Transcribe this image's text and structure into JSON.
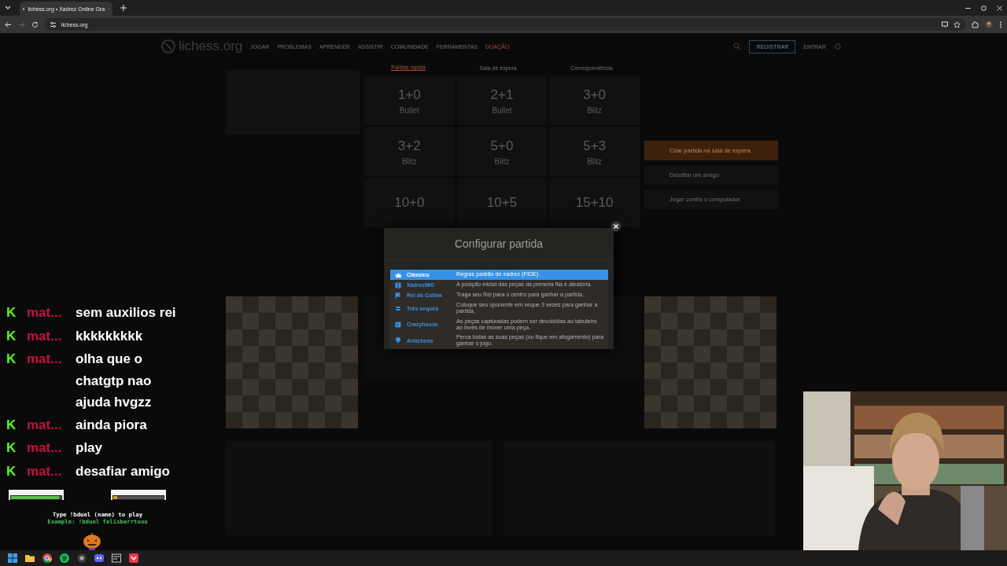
{
  "browser": {
    "tab": {
      "title": "lichess.org • Xadrez Online Gra"
    },
    "address": "lichess.org"
  },
  "site": {
    "logo": "lichess.org",
    "nav": [
      "JOGAR",
      "PROBLEMAS",
      "APRENDER",
      "ASSISTIR",
      "COMUNIDADE",
      "FERRAMENTAS",
      "DOAÇÃO"
    ],
    "register": "REGISTRAR",
    "login": "ENTRAR",
    "pool_tabs": [
      {
        "label": "Partida rápida",
        "selected": true
      },
      {
        "label": "Sala de espera",
        "selected": false
      },
      {
        "label": "Correspondência",
        "selected": false
      }
    ],
    "pools": [
      {
        "time": "1+0",
        "type": "Bullet"
      },
      {
        "time": "2+1",
        "type": "Bullet"
      },
      {
        "time": "3+0",
        "type": "Blitz"
      },
      {
        "time": "3+2",
        "type": "Blitz"
      },
      {
        "time": "5+0",
        "type": "Blitz"
      },
      {
        "time": "5+3",
        "type": "Blitz"
      },
      {
        "time": "10+0"
      },
      {
        "time": "10+5"
      },
      {
        "time": "15+10"
      }
    ],
    "actions": [
      {
        "label": "Criar partida na sala de espera",
        "kind": "primary"
      },
      {
        "label": "Desafiar um amigo",
        "kind": "secondary"
      },
      {
        "label": "Jogar contra o computador",
        "kind": "secondary"
      }
    ]
  },
  "modal": {
    "title": "Configurar partida",
    "variants": [
      {
        "name": "Clássico",
        "description": "Regras padrão de xadrez (FIDE)",
        "selected": true
      },
      {
        "name": "Xadrez960",
        "description": "A posição inicial das peças da primeira fila é aleatória.",
        "selected": false
      },
      {
        "name": "Rei da Colina",
        "description": "Traga seu Rei para o centro para ganhar a partida.",
        "selected": false
      },
      {
        "name": "Três xeques",
        "description": "Coloque seu oponente em xeque 3 vezes para ganhar a partida.",
        "selected": false
      },
      {
        "name": "Crazyhouse",
        "description": "As peças capturadas podem ser devolvidas ao tabuleiro ao invés de mover uma peça.",
        "selected": false
      },
      {
        "name": "Antichess",
        "description": "Perca todas as suas peças (ou fique em afogamento) para ganhar o jogo.",
        "selected": false
      }
    ]
  },
  "chat": {
    "messages": [
      {
        "badge": "K",
        "user": "mat...",
        "lines": [
          "sem auxilios rei"
        ]
      },
      {
        "badge": "K",
        "user": "mat...",
        "lines": [
          "kkkkkkkkk"
        ]
      },
      {
        "badge": "K",
        "user": "mat...",
        "lines": [
          "olha que o",
          "chatgtp nao",
          "ajuda hvgzz"
        ]
      },
      {
        "badge": "K",
        "user": "mat...",
        "lines": [
          "ainda piora"
        ]
      },
      {
        "badge": "K",
        "user": "mat...",
        "lines": [
          "play"
        ]
      },
      {
        "badge": "K",
        "user": "mat...",
        "lines": [
          "desafiar amigo"
        ]
      }
    ],
    "duel_bars": [
      {
        "level": 0.95
      },
      {
        "level": 0.08
      }
    ],
    "hint": "Type !bduel (name) to play",
    "example": "Example: !bduel felisberrtooo"
  }
}
